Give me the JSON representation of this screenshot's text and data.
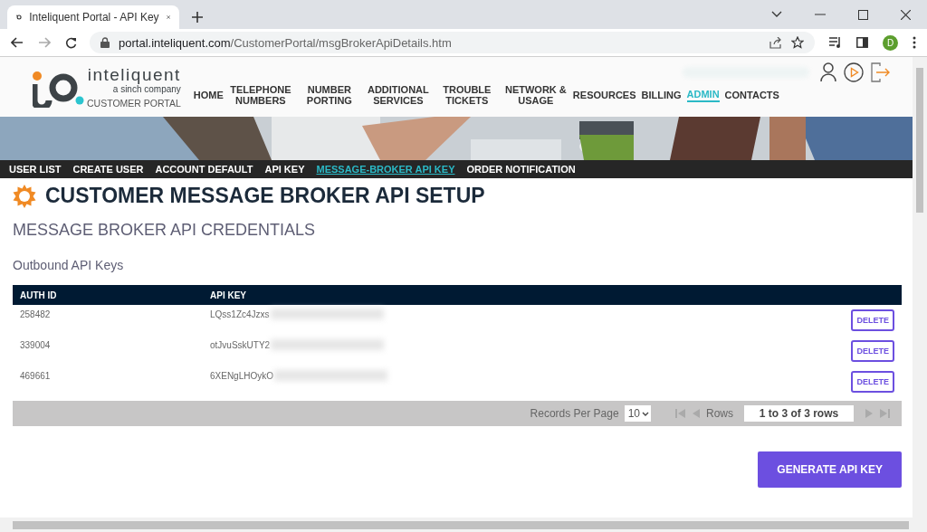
{
  "browser": {
    "tab_title": "Inteliquent Portal - API Key",
    "url_host": "portal.inteliquent.com",
    "url_path": "/CustomerPortal/msgBrokerApiDetails.htm",
    "profile_initial": "D"
  },
  "header": {
    "brand": "inteliquent",
    "brand_sub": "a sinch company",
    "portal_label": "CUSTOMER PORTAL"
  },
  "nav": [
    {
      "label": "HOME",
      "selected": false
    },
    {
      "label": "TELEPHONE NUMBERS",
      "selected": false
    },
    {
      "label": "NUMBER PORTING",
      "selected": false
    },
    {
      "label": "ADDITIONAL SERVICES",
      "selected": false
    },
    {
      "label": "TROUBLE TICKETS",
      "selected": false
    },
    {
      "label": "NETWORK & USAGE",
      "selected": false
    },
    {
      "label": "RESOURCES",
      "selected": false
    },
    {
      "label": "BILLING",
      "selected": false
    },
    {
      "label": "ADMIN",
      "selected": true
    },
    {
      "label": "CONTACTS",
      "selected": false
    }
  ],
  "subnav": [
    {
      "label": "USER LIST",
      "selected": false
    },
    {
      "label": "CREATE USER",
      "selected": false
    },
    {
      "label": "ACCOUNT DEFAULT",
      "selected": false
    },
    {
      "label": "API KEY",
      "selected": false
    },
    {
      "label": "MESSAGE-BROKER API KEY",
      "selected": true
    },
    {
      "label": "ORDER NOTIFICATION",
      "selected": false
    }
  ],
  "page_title": "CUSTOMER MESSAGE BROKER API SETUP",
  "section_title": "MESSAGE BROKER API CREDENTIALS",
  "subsection_title": "Outbound API Keys",
  "table": {
    "columns": [
      "AUTH ID",
      "API KEY"
    ],
    "rows": [
      {
        "auth_id": "258482",
        "api_key": "LQss1Zc4Jzxs",
        "action": "DELETE"
      },
      {
        "auth_id": "339004",
        "api_key": "otJvuSskUTY2",
        "action": "DELETE"
      },
      {
        "auth_id": "469661",
        "api_key": "6XENgLHOykO",
        "action": "DELETE"
      }
    ],
    "footer": {
      "records_label": "Records Per Page",
      "records_value": "10",
      "rows_label": "Rows",
      "rows_value": "1 to 3 of 3 rows"
    }
  },
  "primary_button": "GENERATE API KEY"
}
